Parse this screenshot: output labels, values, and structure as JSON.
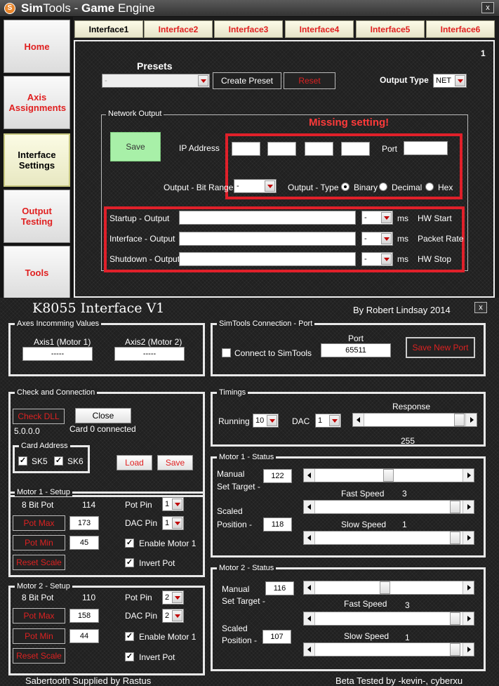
{
  "window": {
    "title_prefix": "Sim",
    "title_mid": "Tools - ",
    "title_game": "Game",
    " title_end": "",
    "title_engine": " Engine",
    "close": "x"
  },
  "sidebar": {
    "items": [
      {
        "label": "Home"
      },
      {
        "label": "Axis Assignments"
      },
      {
        "label": "Interface Settings"
      },
      {
        "label": "Output Testing"
      },
      {
        "label": "Tools"
      }
    ]
  },
  "tabs": [
    {
      "label": "Interface1"
    },
    {
      "label": "Interface2"
    },
    {
      "label": "Interface3"
    },
    {
      "label": "Interface4"
    },
    {
      "label": "Interface5"
    },
    {
      "label": "Interface6"
    }
  ],
  "main": {
    "page_number": "1",
    "presets_label": "Presets",
    "preset_value": "-",
    "create_preset": "Create Preset",
    "reset": "Reset",
    "output_type_label": "Output Type",
    "output_type_value": "NET",
    "network_output_title": "Network Output",
    "missing_setting": "Missing setting!",
    "save": "Save",
    "ip_address": "IP Address",
    "port": "Port",
    "bit_range_label": "Output - Bit Range",
    "bit_range_value": "-",
    "output_type2": "Output - Type",
    "radio_binary": "Binary",
    "radio_decimal": "Decimal",
    "radio_hex": "Hex",
    "startup_output": "Startup - Output",
    "interface_output": "Interface - Output",
    "shutdown_output": "Shutdown - Output",
    "ms_value": "-",
    "ms": "ms",
    "hw_start": "HW Start",
    "packet_rate": "Packet Rate",
    "hw_stop": "HW Stop"
  },
  "k8055": {
    "title": "K8055 Interface V1",
    "author": "By Robert Lindsay 2014",
    "close": "x",
    "axes_title": "Axes Incomming Values",
    "axis1_label": "Axis1 (Motor 1)",
    "axis1_value": "-----",
    "axis2_label": "Axis2 (Motor 2)",
    "axis2_value": "-----",
    "simtools_title": "SimTools Connection - Port",
    "port_label": "Port",
    "port_value": "65511",
    "connect_label": "Connect to SimTools",
    "save_new_port": "Save New Port",
    "check_title": "Check and Connection",
    "check_dll": "Check DLL",
    "close_btn": "Close",
    "version": "5.0.0.0",
    "card_status": "Card  0 connected",
    "card_address_title": "Card Address",
    "sk5": "SK5",
    "sk6": "SK6",
    "load": "Load",
    "save": "Save",
    "timings_title": "Timings",
    "running_label": "Running",
    "running_value": "10",
    "dac_label": "DAC",
    "dac_value": "1",
    "response_label": "Response",
    "response_value": "255",
    "motor1_setup": {
      "title": "Motor 1 - Setup",
      "pot_label": "8 Bit Pot",
      "pot_value": "114",
      "pot_pin_label": "Pot Pin",
      "pot_pin_value": "1",
      "pot_max": "Pot Max",
      "pot_max_value": "173",
      "dac_pin_label": "DAC Pin",
      "dac_pin_value": "1",
      "pot_min": "Pot Min",
      "pot_min_value": "45",
      "enable": "Enable Motor 1",
      "reset_scale": "Reset Scale",
      "invert": "Invert Pot"
    },
    "motor2_setup": {
      "title": "Motor 2 - Setup",
      "pot_label": "8 Bit Pot",
      "pot_value": "110",
      "pot_pin_label": "Pot Pin",
      "pot_pin_value": "2",
      "pot_max": "Pot Max",
      "pot_max_value": "158",
      "dac_pin_label": "DAC Pin",
      "dac_pin_value": "2",
      "pot_min": "Pot Min",
      "pot_min_value": "44",
      "enable": "Enable Motor 1",
      "reset_scale": "Reset Scale",
      "invert": "Invert Pot"
    },
    "motor1_status": {
      "title": "Motor 1 - Status",
      "manual_label": "Manual",
      "set_target_label": "Set Target -",
      "set_target_value": "122",
      "fast_speed_label": "Fast Speed",
      "fast_speed_value": "3",
      "scaled_label": "Scaled",
      "position_label": "Position -",
      "position_value": "118",
      "slow_speed_label": "Slow Speed",
      "slow_speed_value": "1"
    },
    "motor2_status": {
      "title": "Motor 2 - Status",
      "manual_label": "Manual",
      "set_target_label": "Set Target -",
      "set_target_value": "116",
      "fast_speed_label": "Fast Speed",
      "fast_speed_value": "3",
      "scaled_label": "Scaled",
      "position_label": "Position -",
      "position_value": "107",
      "slow_speed_label": "Slow Speed",
      "slow_speed_value": "1"
    },
    "footer_left": "Sabertooth Supplied by Rastus",
    "footer_right": "Beta Tested by  -kevin-, cyberxu"
  },
  "colors": {
    "accent_red": "#e0202a",
    "save_green": "#a8f0a8"
  }
}
